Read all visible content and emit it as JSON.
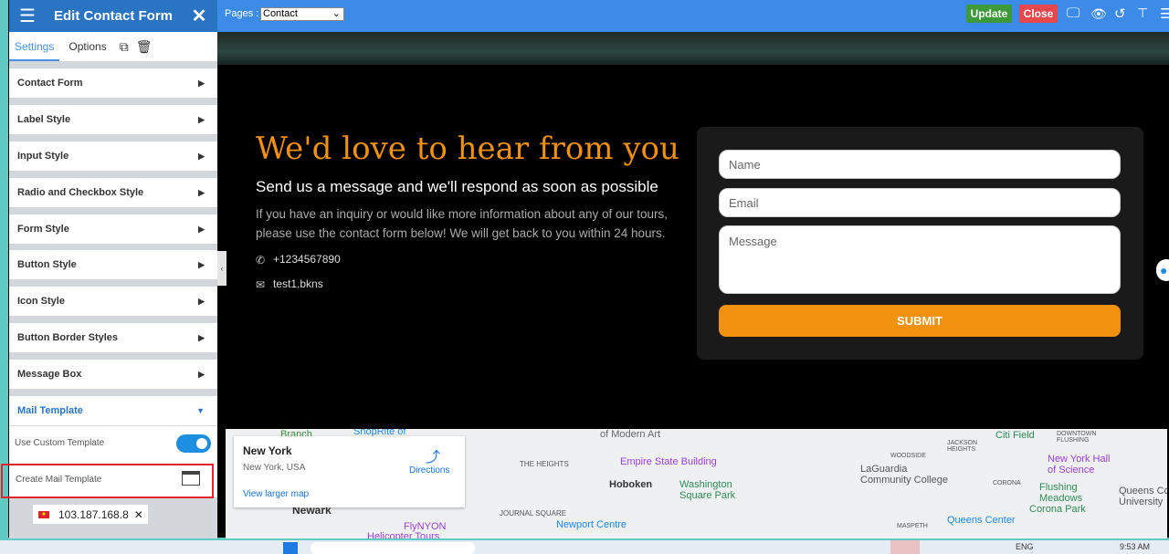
{
  "sidebar": {
    "title": "Edit Contact Form",
    "tabs": [
      "Settings",
      "Options"
    ],
    "items": [
      "Contact Form",
      "Label Style",
      "Input Style",
      "Radio and Checkbox Style",
      "Form Style",
      "Button Style",
      "Icon Style",
      "Button Border Styles",
      "Message Box",
      "Mail Template"
    ],
    "use_custom_template": "Use Custom Template",
    "use_custom_template_on": true,
    "create_mail_template": "Create Mail Template",
    "ip": "103.187.168.8"
  },
  "topbar": {
    "pages_label": "Pages :",
    "pages_value": "Contact",
    "update": "Update",
    "close": "Close",
    "colors": {
      "update": "#3d9a3a",
      "close": "#e8474b"
    }
  },
  "content": {
    "heading": "We'd love to hear from you",
    "subheading": "Send us a message and we'll respond as soon as possible",
    "body": "If you have an inquiry or would like more information about any of our tours, please use the contact form below! We will get back to you within 24 hours.",
    "phone": "+1234567890",
    "email": "test1.bkns"
  },
  "form": {
    "name_ph": "Name",
    "email_ph": "Email",
    "message_ph": "Message",
    "submit": "SUBMIT",
    "accent": "#f0920f"
  },
  "map": {
    "place": "New York",
    "place_sub": "New York, USA",
    "directions": "Directions",
    "larger": "View larger map",
    "labels": [
      "Branch",
      "ShopRite of",
      "of Modern Art",
      "THE HEIGHTS",
      "Empire State Building",
      "Hoboken",
      "Washington",
      "Square Park",
      "JOURNAL SQUARE",
      "Newport Centre",
      "Newark",
      "FlyNYON",
      "Helicopter Tours",
      "Citi Field",
      "DOWNTOWN FLUSHING",
      "JACKSON HEIGHTS",
      "WOODSIDE",
      "New York Hall",
      "of Science",
      "LaGuardia",
      "Community College",
      "CORONA",
      "Flushing",
      "Meadows",
      "Corona Park",
      "Queens College",
      "University",
      "Queens Center",
      "MASPETH"
    ]
  },
  "taskbar": {
    "lang": "ENG",
    "time": "9:53 AM"
  }
}
